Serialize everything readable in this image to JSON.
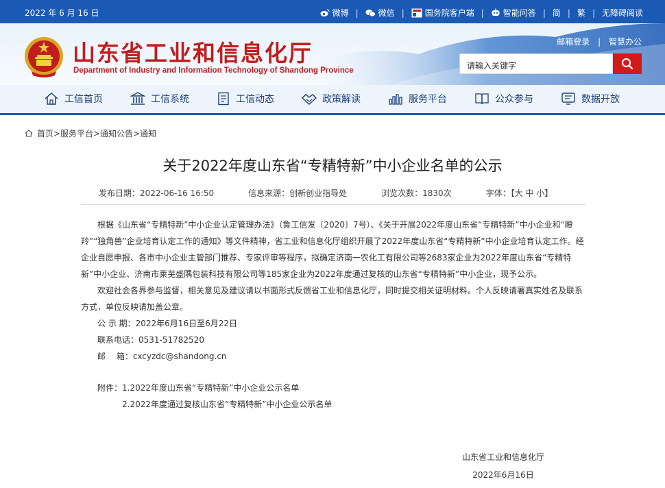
{
  "topbar": {
    "date": "2022 年 6 月 16 日",
    "links": [
      {
        "icon": "weibo-icon",
        "label": "微博"
      },
      {
        "icon": "wechat-icon",
        "label": "微信"
      },
      {
        "icon": "state-council-app-icon",
        "label": "国务院客户端"
      },
      {
        "icon": "robot-icon",
        "label": "智能问答"
      },
      {
        "label": "简"
      },
      {
        "label": "繁"
      },
      {
        "label": "无障碍阅读"
      }
    ]
  },
  "header": {
    "title": "山东省工业和信息化厅",
    "subtitle": "Department of Industry and Information Technology of Shandong Province",
    "mail_login": "邮箱登录",
    "smart_office": "智慧办公",
    "search_placeholder": "请输入关键字"
  },
  "nav": [
    {
      "icon": "home-icon",
      "label": "工信首页"
    },
    {
      "icon": "building-icon",
      "label": "工信系统"
    },
    {
      "icon": "document-icon",
      "label": "工信动态"
    },
    {
      "icon": "handshake-icon",
      "label": "政策解读"
    },
    {
      "icon": "chart-icon",
      "label": "服务平台"
    },
    {
      "icon": "book-icon",
      "label": "公众参与"
    },
    {
      "icon": "data-icon",
      "label": "数据开放"
    }
  ],
  "breadcrumb": "首页>服务平台>通知公告>通知",
  "article": {
    "title": "关于2022年度山东省“专精特新”中小企业名单的公示",
    "meta": {
      "date": "发布日期：2022-06-16 16:50",
      "source": "信息来源：创新创业指导处",
      "views": "浏览次数：1830次",
      "font": "字体：【大 中 小】"
    },
    "para1": "根据《山东省“专精特新”中小企业认定管理办法》（鲁工信发〔2020〕7号）、《关于开展2022年度山东省“专精特新”中小企业和“瞪羚”“独角兽”企业培育认定工作的通知》等文件精神，省工业和信息化厅组织开展了2022年度山东省“专精特新”中小企业培育认定工作。经企业自愿申报、各市中小企业主管部门推荐、专家评审等程序，拟确定济南一农化工有限公司等2683家企业为2022年度山东省“专精特新”中小企业、济南市莱芜盛隅包装科技有限公司等185家企业为2022年度通过复核的山东省“专精特新”中小企业，现予公示。",
    "para2": "欢迎社会各界参与监督，相关意见及建议请以书面形式反馈省工业和信息化厅，同时提交相关证明材料。个人反映请署真实姓名及联系方式，单位反映请加盖公章。",
    "period": "公 示 期：2022年6月16日至6月22日",
    "phone": "联系电话：0531-51782520",
    "email": "邮　 箱：cxcyzdc@shandong.cn",
    "attachment1": "附件：1.2022年度山东省“专精特新”中小企业公示名单",
    "attachment2": "2.2022年度通过复核山东省“专精特新”中小企业公示名单",
    "signature_org": "山东省工业和信息化厅",
    "signature_date": "2022年6月16日"
  },
  "colors": {
    "topbar": "#1a5ab5",
    "title_red": "#c21d1d",
    "search_button": "#d11a1a",
    "nav_text": "#1b3f7a"
  }
}
